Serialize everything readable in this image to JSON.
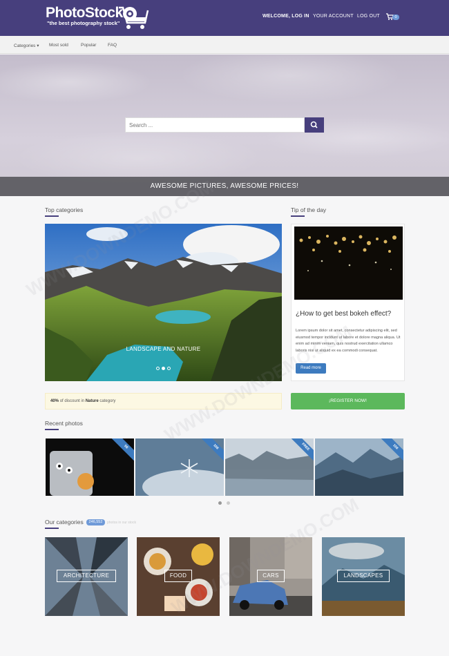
{
  "header": {
    "logo_title": "PhotoStock",
    "logo_tagline": "\"the best photography stock\"",
    "nav": {
      "welcome_prefix": "WELCOME,",
      "login": "LOG IN",
      "account": "YOUR ACCOUNT",
      "logout": "LOG OUT"
    },
    "cart_count": "0",
    "brand_color": "#473f7d"
  },
  "subnav": {
    "categories": "Categories",
    "most_sold": "Most sold",
    "popular": "Popular",
    "faq": "FAQ"
  },
  "hero": {
    "search_placeholder": "Search ...",
    "banner": "AWESOME PICTURES, AWESOME PRICES!"
  },
  "top_categories": {
    "title": "Top categories",
    "slide_caption": "LANDSCAPE AND NATURE",
    "slide_count": 3,
    "active_slide": 2
  },
  "tip": {
    "title": "Tip of the day",
    "headline": "¿How to get best bokeh effect?",
    "body": "Lorem ipsum dolor sit amet, consectetur adipiscing elit, sed eiusmod tempor incidunt ut labore et dolore magna aliqua. Ut enim ad minim veniam, quis nostrud exercitation ullamco laboris nisi ut aliquid ex ea commodi consequat.",
    "button": "Read more"
  },
  "promo": {
    "discount_value": "40%",
    "discount_mid": "of discount in",
    "discount_category": "Nature",
    "discount_tail": "category",
    "register": "¡REGISTER NOW!",
    "register_color": "#5cb85c"
  },
  "recent": {
    "title": "Recent photos",
    "ribbons": [
      "5$",
      "10$",
      "FREE",
      "15$"
    ]
  },
  "our_categories": {
    "title": "Our categories",
    "count": "246,552",
    "count_label": "photos in our stock",
    "items": [
      "ARCHITECTURE",
      "FOOD",
      "CARS",
      "LANDSCAPES"
    ]
  },
  "watermark_text": "WWW.DOWNDEMO.COM"
}
